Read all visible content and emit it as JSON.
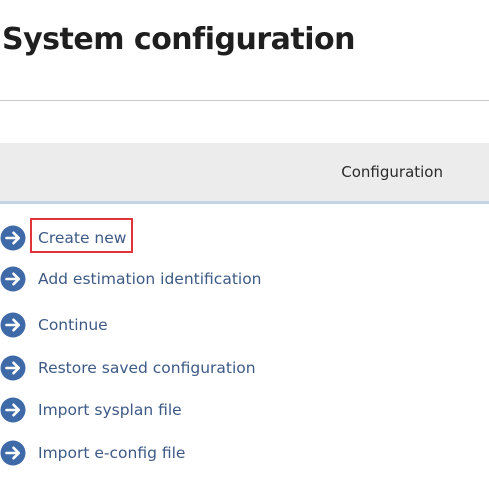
{
  "page": {
    "title": "System configuration"
  },
  "table": {
    "header_label": "Configuration"
  },
  "actions": [
    {
      "label": "Create new",
      "icon": "arrow-right-circle-icon",
      "highlighted": true
    },
    {
      "label": "Add estimation identification",
      "icon": "arrow-right-circle-icon",
      "highlighted": false
    },
    {
      "label": "Continue",
      "icon": "arrow-right-circle-icon",
      "highlighted": false
    },
    {
      "label": "Restore saved configuration",
      "icon": "arrow-right-circle-icon",
      "highlighted": false
    },
    {
      "label": "Import sysplan file",
      "icon": "arrow-right-circle-icon",
      "highlighted": false
    },
    {
      "label": "Import e-config file",
      "icon": "arrow-right-circle-icon",
      "highlighted": false
    }
  ],
  "colors": {
    "icon": "#3f6aa8",
    "link_text": "#3d5a86",
    "highlight": "#e0343a",
    "header_bg": "#ececec",
    "header_border": "#c2d4e6"
  }
}
